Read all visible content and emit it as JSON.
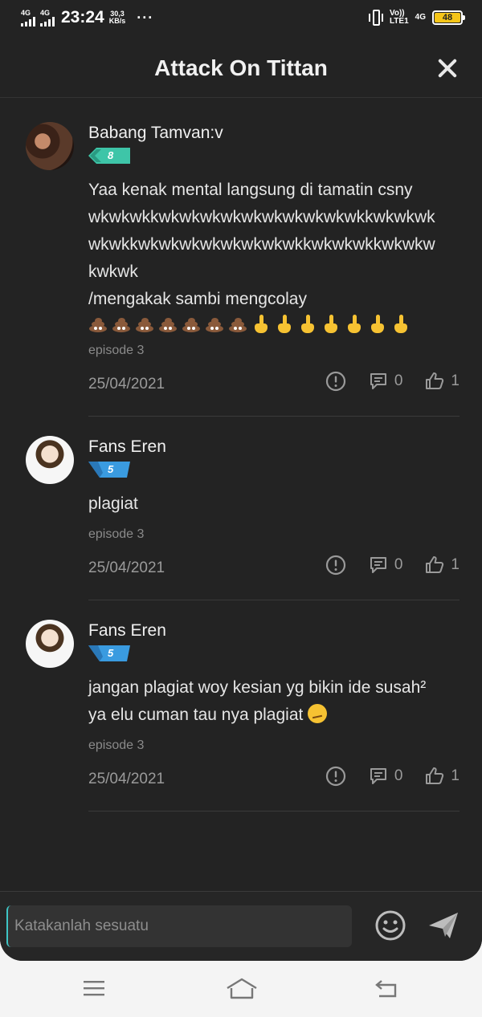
{
  "status_bar": {
    "net1": "4G",
    "net2": "4G",
    "time": "23:24",
    "speed_value": "30,3",
    "speed_unit": "KB/s",
    "more": "···",
    "volte_top": "Vo))",
    "volte_bottom": "LTE1",
    "net3": "4G",
    "battery": "48"
  },
  "header": {
    "title": "Attack On Tittan"
  },
  "comments": [
    {
      "username": "Babang Tamvan:v",
      "level": "8",
      "text_lines": [
        "Yaa kenak mental langsung di tamatin csny",
        "wkwkwkkwkwkwkwkwkwkwkwkwkwkkwkwkwk",
        "wkwkkwkwkwkwkwkwkwkwkkwkwkwkkwkwkw",
        "kwkwk",
        "/mengakak sambi mengcolay"
      ],
      "episode": "episode 3",
      "date": "25/04/2021",
      "reply_count": "0",
      "like_count": "1"
    },
    {
      "username": "Fans Eren",
      "level": "5",
      "text_lines": [
        "plagiat"
      ],
      "episode": "episode 3",
      "date": "25/04/2021",
      "reply_count": "0",
      "like_count": "1"
    },
    {
      "username": "Fans Eren",
      "level": "5",
      "text_lines": [
        "jangan plagiat woy kesian yg bikin ide susah²",
        "ya elu cuman tau nya plagiat"
      ],
      "episode": "episode 3",
      "date": "25/04/2021",
      "reply_count": "0",
      "like_count": "1"
    }
  ],
  "input": {
    "placeholder": "Katakanlah sesuatu"
  },
  "icons": {
    "close": "close-icon",
    "report": "alert-circle-icon",
    "reply": "comment-icon",
    "like": "thumbs-up-icon",
    "emoji": "smiley-icon",
    "send": "send-icon",
    "menu": "menu-icon",
    "home": "home-icon",
    "back": "back-icon"
  },
  "colors": {
    "background": "#232323",
    "badge_level8": "#3ec5a8",
    "badge_level5": "#3a9be0",
    "text": "#e6e6e6",
    "muted": "#9a9a9a"
  }
}
